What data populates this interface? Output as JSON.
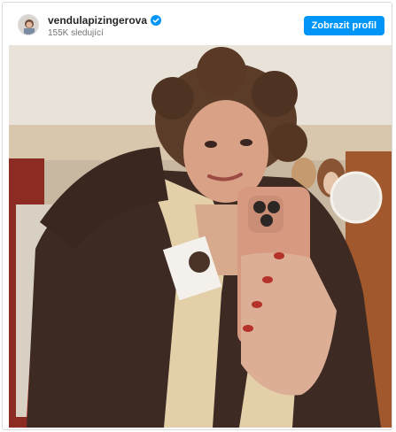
{
  "post": {
    "username": "vendulapizingerova",
    "followers": "155K sledující",
    "view_profile_label": "Zobrazit profil",
    "verified": true,
    "verified_color": "#0095f6"
  },
  "photo": {
    "alt": "Mirror selfie of a woman with curly brown wig in shearling jacket holding a pink phone"
  }
}
